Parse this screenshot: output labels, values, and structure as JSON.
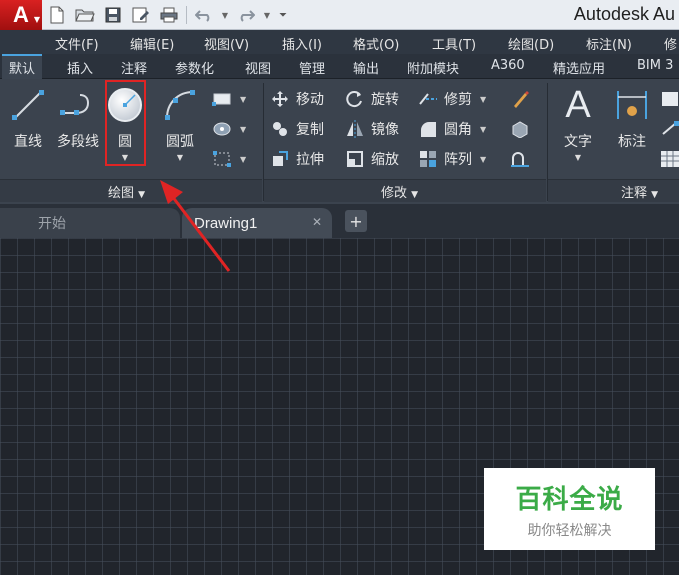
{
  "app": {
    "title": "Autodesk Au",
    "logo_letter": "A"
  },
  "quick_access": {
    "icons": [
      "new-file-icon",
      "open-folder-icon",
      "save-icon",
      "save-as-icon",
      "print-icon",
      "undo-icon",
      "redo-icon",
      "customize-dropdown-icon"
    ]
  },
  "menu": {
    "items": [
      "文件(F)",
      "编辑(E)",
      "视图(V)",
      "插入(I)",
      "格式(O)",
      "工具(T)",
      "绘图(D)",
      "标注(N)",
      "修"
    ]
  },
  "ribbon_tabs": {
    "items": [
      "默认",
      "插入",
      "注释",
      "参数化",
      "视图",
      "管理",
      "输出",
      "附加模块",
      "A360",
      "精选应用",
      "BIM 3"
    ],
    "active": "默认"
  },
  "draw_panel": {
    "title": "绘图",
    "tools": {
      "line": "直线",
      "polyline": "多段线",
      "circle": "圆",
      "arc": "圆弧"
    }
  },
  "modify_panel": {
    "title": "修改",
    "tools": {
      "move": "移动",
      "rotate": "旋转",
      "trim": "修剪",
      "copy": "复制",
      "mirror": "镜像",
      "fillet": "圆角",
      "stretch": "拉伸",
      "scale": "缩放",
      "array": "阵列"
    }
  },
  "annotation_panel": {
    "title": "注释",
    "tools": {
      "text": "文字",
      "dimension": "标注"
    }
  },
  "doc_tabs": {
    "start": "开始",
    "drawing": "Drawing1",
    "close_glyph": "✕",
    "add_glyph": "+"
  },
  "watermark": {
    "line1": "百科全说",
    "line2": "助你轻松解决"
  },
  "colors": {
    "highlight": "#e02424",
    "accent": "#4aa3df",
    "watermark_green": "#3bab47"
  }
}
